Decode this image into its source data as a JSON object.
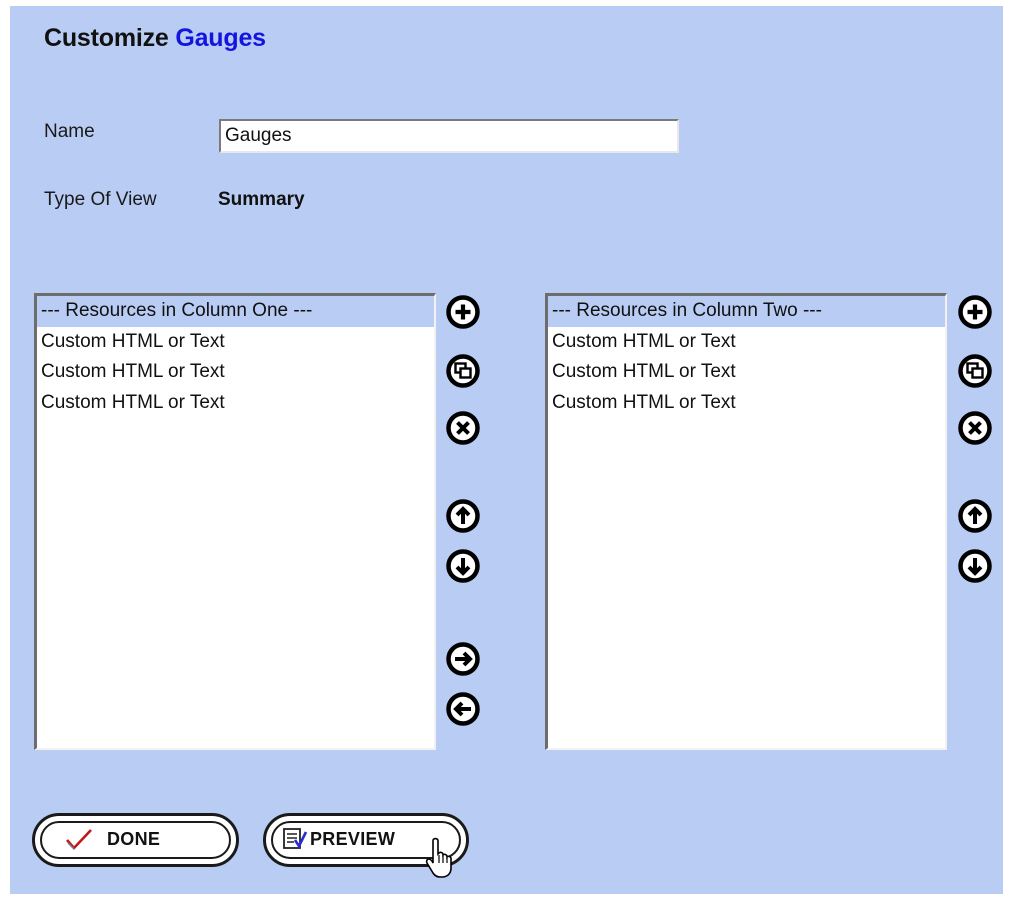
{
  "header": {
    "title_prefix": "Customize",
    "title_accent": "Gauges"
  },
  "form": {
    "name_label": "Name",
    "name_value": "Gauges",
    "type_label": "Type Of View",
    "type_value": "Summary"
  },
  "columns": [
    {
      "header": "--- Resources in Column One ---",
      "items": [
        "Custom HTML or Text",
        "Custom HTML or Text",
        "Custom HTML or Text"
      ]
    },
    {
      "header": "--- Resources in Column Two ---",
      "items": [
        "Custom HTML or Text",
        "Custom HTML or Text",
        "Custom HTML or Text"
      ]
    }
  ],
  "icons": {
    "add": "plus-circle-icon",
    "copy": "copy-circle-icon",
    "delete": "x-circle-icon",
    "up": "arrow-up-circle-icon",
    "down": "arrow-down-circle-icon",
    "right": "arrow-right-circle-icon",
    "left": "arrow-left-circle-icon"
  },
  "buttons": {
    "done": "DONE",
    "preview": "PREVIEW"
  },
  "colors": {
    "panel_bg": "#b9ccf4",
    "accent": "#1414e0",
    "selected_row": "#b9ccf4"
  }
}
